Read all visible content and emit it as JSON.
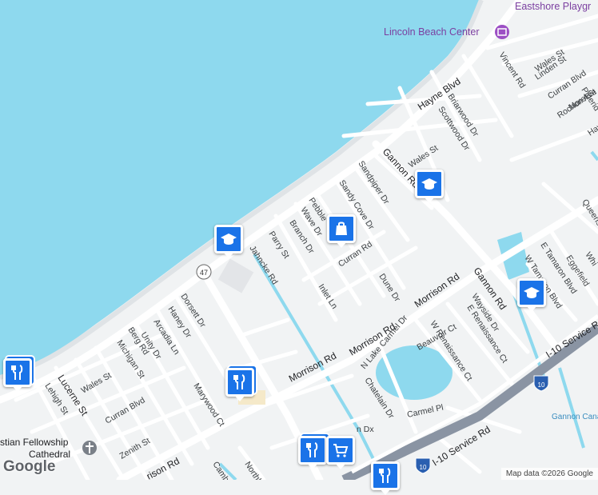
{
  "map": {
    "colors": {
      "water": "#8ed9ee",
      "land": "#f1f3f4",
      "road": "#ffffff",
      "highway": "#8a94a3",
      "pin": "#1a73e8",
      "poi_text": "#7b3fa0"
    },
    "pois": {
      "lincoln_beach": "Lincoln Beach Center",
      "eastshore": "Eastshore Playgr",
      "gannon_canal": "Gannon Cana",
      "cathedral_line1": "stian Fellowship",
      "cathedral_line2": "Cathedral"
    },
    "streets": {
      "hayne": "Hayne Blvd",
      "morrison_1": "Morrison Rd",
      "morrison_2": "Morrison Rd",
      "morrison_3": "Morrison Rd",
      "morrison_4": "rison Rd",
      "gannon_1": "Gannon Rd",
      "gannon_2": "Gannon Rd",
      "i10_service": "I-10 Service Rd",
      "i10_service_2": "I-10 Service R",
      "jahncke": "Jahncke Rd",
      "parry": "Parry St",
      "branch": "Branch Dr",
      "wave": "Wave Dr",
      "pebble": "Pebble",
      "sandy_cove": "Sandy Cove Dr",
      "sandpiper": "Sandpiper Dr",
      "curran_top": "Curran Rd",
      "inlet": "Inlet Ln",
      "dune": "Dune Dr",
      "wales_1": "Wales St",
      "wales_2": "Wales St",
      "wales_3": "Wales St",
      "briarwood": "Briarwood Dr",
      "scottwood": "Scottwood Dr",
      "vincent": "Vincent Rd",
      "linden": "Linden St",
      "curran_blvd_1": "Curran Blvd",
      "curran_blvd_2": "Curran Blvd",
      "pinerid": "Pinerid",
      "morel": "Morel St",
      "rochon": "Rochon Ave",
      "hayne_r": "Hay",
      "queens": "Queens",
      "whi": "Whi",
      "eggefield": "Eggefield",
      "e_tamaron": "E Tamaron Blvd",
      "w_tamaron": "W Tamaron Blvd",
      "wayside": "Wayside Dr",
      "e_renaissance": "E Renaissance Ct",
      "w_renaissance": "W Renaissance Ct",
      "beauvoir": "Beauvoir Ct",
      "n_lake_carmel": "N Lake Carmel Dr",
      "chatelain": "Chatelain Dr",
      "carmel_pl": "Carmel Pl",
      "dorsett": "Dorsett Dr",
      "haney": "Haney Dr",
      "arcadia": "Arcadia Ln",
      "unity": "Unity Dr",
      "berg": "Berg Rd",
      "michigan": "Michigan St",
      "lucerne": "Lucerne St",
      "lehigh": "Lehigh St",
      "zenith": "Zenith St",
      "marywood": "Marywood Ct",
      "camb": "Camb",
      "northl": "Northl",
      "dx": "n Dx",
      "shield_47": "47",
      "shield_i10_a": "10",
      "shield_i10_b": "10"
    },
    "markers": [
      {
        "name": "school-marker",
        "icon": "school-icon"
      },
      {
        "name": "school-marker",
        "icon": "school-icon"
      },
      {
        "name": "school-marker",
        "icon": "school-icon"
      },
      {
        "name": "shopping-marker",
        "icon": "shopping-bag-icon"
      },
      {
        "name": "restaurant-marker",
        "icon": "fork-knife-icon"
      },
      {
        "name": "restaurant-marker",
        "icon": "fork-knife-icon"
      },
      {
        "name": "restaurant-marker",
        "icon": "fork-knife-icon"
      },
      {
        "name": "restaurant-marker",
        "icon": "fork-knife-icon"
      },
      {
        "name": "grocery-marker",
        "icon": "shopping-cart-icon"
      }
    ],
    "logo": "Google",
    "attribution": "Map data ©2026 Google"
  }
}
